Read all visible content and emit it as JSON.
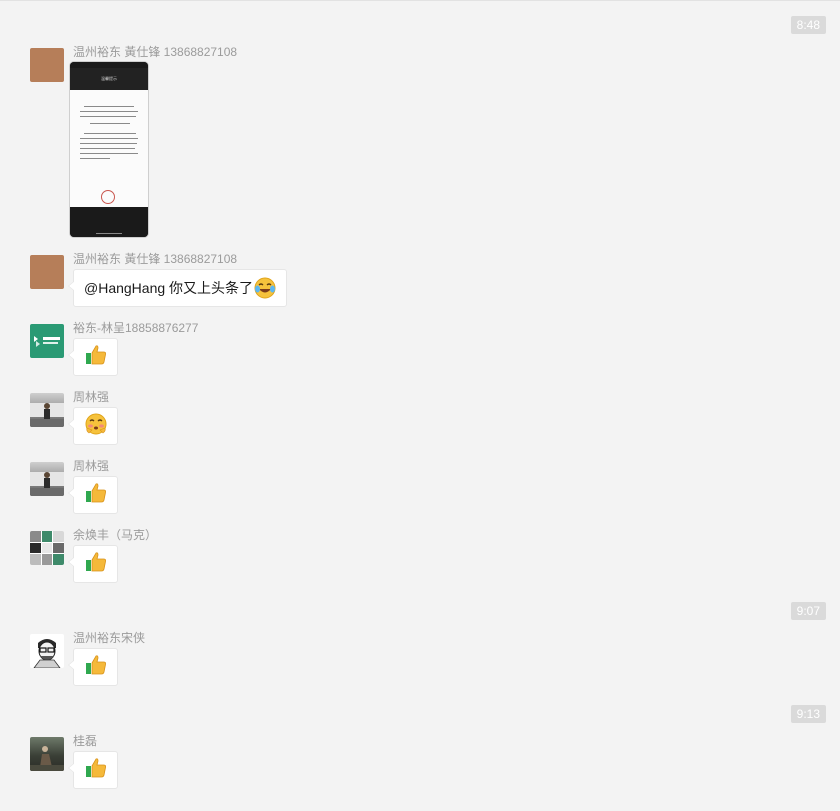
{
  "chat": {
    "timestamps": [
      "8:48",
      "9:07",
      "9:13"
    ],
    "messages": [
      {
        "sender": "温州裕东 黃仕锋 13868827108",
        "type": "image",
        "avatar_color": "#b67e59",
        "image_header": "温馨提示"
      },
      {
        "sender": "温州裕东 黃仕锋 13868827108",
        "type": "text",
        "avatar_color": "#b67e59",
        "text": "@HangHang 你又上头条了",
        "trailing_emoji": "laugh-crying-emoji"
      },
      {
        "sender": "裕东-林呈18858876277",
        "type": "emoji",
        "emoji": "thumbs-up-icon",
        "avatar_label": "SLE MOTION",
        "avatar_color": "#2a9a74"
      },
      {
        "sender": "周林强",
        "type": "emoji",
        "emoji": "blushing-face-icon"
      },
      {
        "sender": "周林强",
        "type": "emoji",
        "emoji": "thumbs-up-icon"
      },
      {
        "sender": "余焕丰（马克）",
        "type": "emoji",
        "emoji": "thumbs-up-icon"
      },
      {
        "sender": "温州裕东宋侠",
        "type": "emoji",
        "emoji": "thumbs-up-icon"
      },
      {
        "sender": "桂磊",
        "type": "emoji",
        "emoji": "thumbs-up-icon"
      }
    ]
  },
  "colors": {
    "background": "#f3f3f3",
    "bubble": "#ffffff",
    "sender_text": "#9b9b9b",
    "time_badge": "#dadada"
  }
}
